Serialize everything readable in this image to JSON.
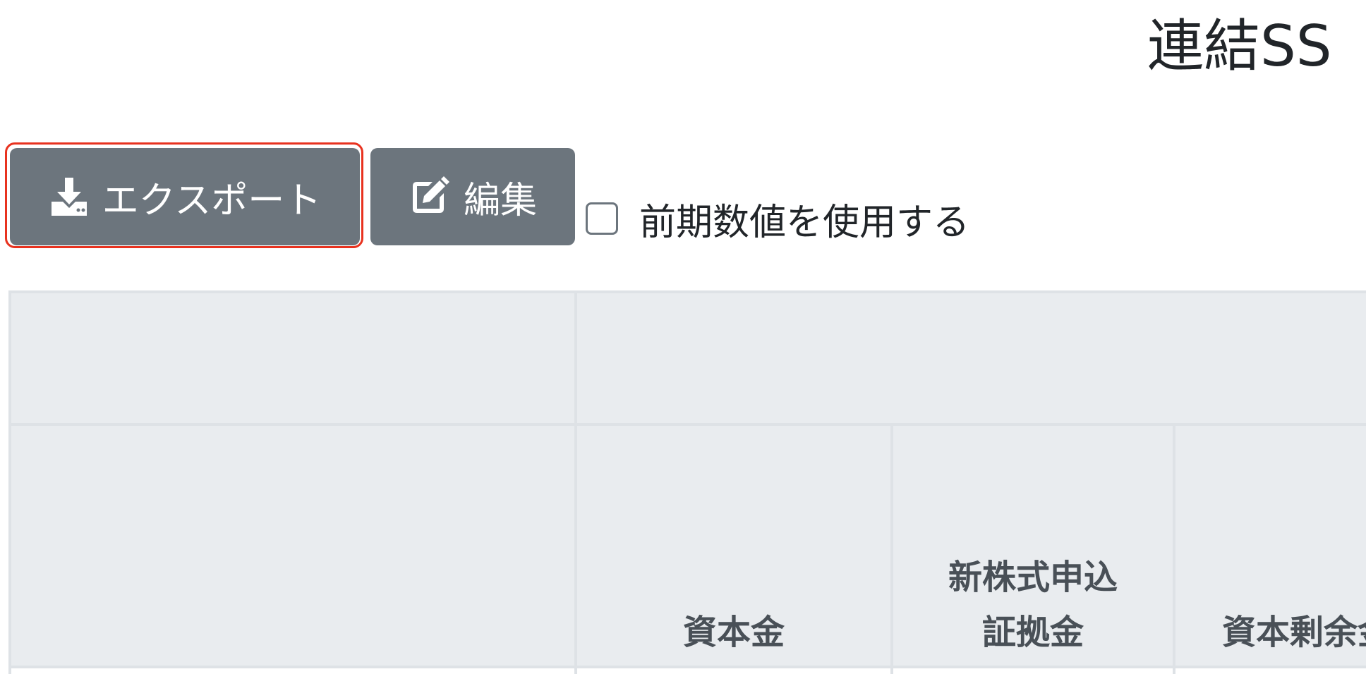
{
  "page": {
    "title": "連結SS"
  },
  "toolbar": {
    "export_label": "エクスポート",
    "export_icon": "download-icon",
    "edit_label": "編集",
    "edit_icon": "edit-icon",
    "use_previous_label": "前期数値を使用する",
    "use_previous_checked": false
  },
  "table": {
    "columns": [
      {
        "lines": [
          ""
        ]
      },
      {
        "lines": [
          "資本金"
        ]
      },
      {
        "lines": [
          "新株式申込",
          "証拠金"
        ]
      },
      {
        "lines": [
          "資本剰余金"
        ]
      }
    ]
  },
  "colors": {
    "button_bg": "#6c757d",
    "focus_ring": "#e8321f",
    "header_bg": "#e9ecef",
    "border": "#dee2e6"
  }
}
